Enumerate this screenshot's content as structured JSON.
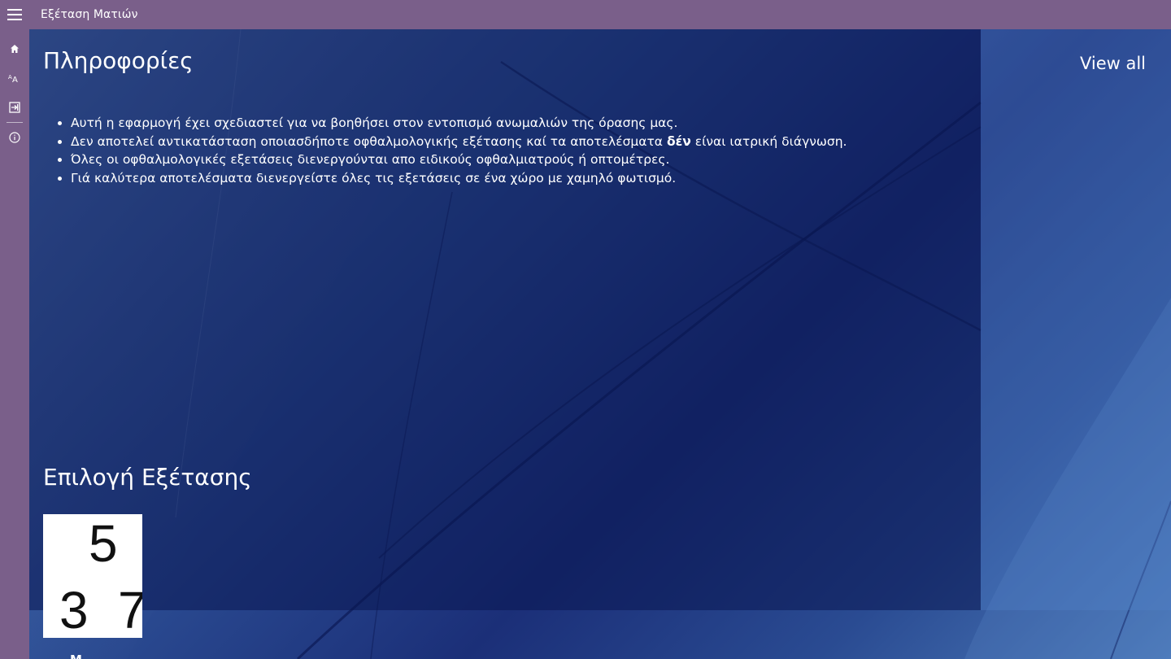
{
  "app": {
    "title": "Εξέταση Ματιών"
  },
  "rail": {
    "items": [
      {
        "name": "home",
        "icon": "home-icon"
      },
      {
        "name": "font",
        "icon": "font-size-icon"
      },
      {
        "name": "exit",
        "icon": "sign-out-icon"
      },
      {
        "name": "about",
        "icon": "info-icon"
      }
    ]
  },
  "info": {
    "title": "Πληροφορίες",
    "view_all": "View all",
    "items": [
      {
        "text": "Αυτή η εφαρμογή έχει σχεδιαστεί για να βοηθήσει στον εντοπισμό ανωμαλιών της όρασης μας."
      },
      {
        "before": "Δεν αποτελεί αντικατάσταση οποιασδήποτε οφθαλμολογικής εξέτασης καί τα αποτελέσματα ",
        "bold": "δέν",
        "after": " είναι ιατρική διάγνωση."
      },
      {
        "text": "Όλες οι οφθαλμολογικές εξετάσεις διενεργούνται απο ειδικούς οφθαλμιατρούς ή οπτομέτρες."
      },
      {
        "text": "Γιά καλύτερα αποτελέσματα διενεργείστε όλες τις εξετάσεις σε ένα χώρο με χαμηλό φωτισμό."
      }
    ]
  },
  "tests": {
    "title": "Επιλογή Εξέτασης",
    "tile_digits": [
      "5",
      "3",
      "7"
    ],
    "tile_caption": "Μ..."
  },
  "colors": {
    "chrome": "#7a5f8a",
    "panel": "#0a1650",
    "text": "#ffffff"
  }
}
